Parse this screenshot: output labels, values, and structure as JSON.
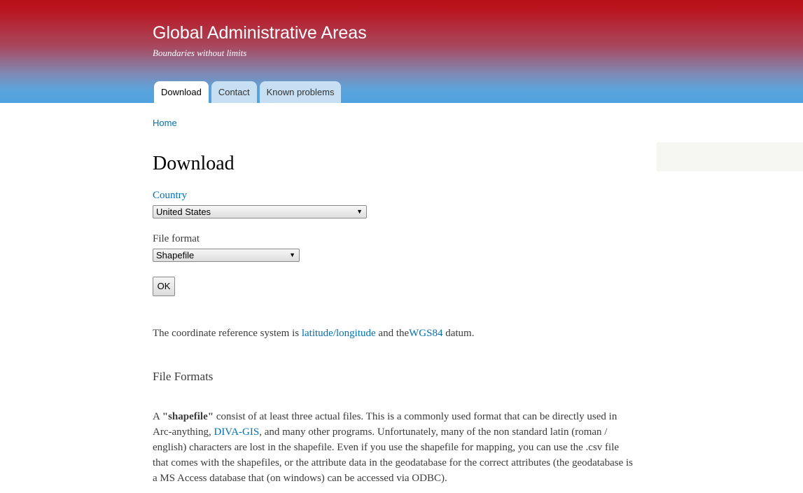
{
  "header": {
    "site_name": "Global Administrative Areas",
    "slogan": "Boundaries without limits",
    "colors": {
      "top": "#b80f16",
      "bottom": "#4fa2df"
    }
  },
  "tabs": [
    {
      "label": "Download",
      "active": true
    },
    {
      "label": "Contact",
      "active": false
    },
    {
      "label": "Known problems",
      "active": false
    }
  ],
  "breadcrumb": {
    "home": "Home"
  },
  "main": {
    "title": "Download",
    "form": {
      "country_label": "Country",
      "country_value": "United States",
      "format_label": "File format",
      "format_value": "Shapefile",
      "ok_label": "OK"
    },
    "crs": {
      "text_1": "The coordinate reference system is ",
      "link_1": "latitude/longitude",
      "text_2": " and the",
      "link_2": "WGS84",
      "text_3": " datum."
    },
    "file_formats_title": "File Formats",
    "shapefile": {
      "text_1": "A ",
      "bold": "\"shapefile\"",
      "text_2": " consist of at least three actual files. This is a commonly used format that can be directly used in Arc-anything, ",
      "link": "DIVA-GIS",
      "text_3": ", and many other programs. Unfortunately, many of the non standard latin (roman / english) characters are lost in the shapefile. Even if you use the shapefile for mapping, you can use the .csv file that comes with the shapefiles, or the attribute data in the geodatabase for the correct attributes (the geodatabase is a MS Access database that (on windows) can be accessed via ODBC)."
    }
  },
  "icons": {
    "select_arrow": "chevron-down-icon"
  },
  "accent_color": "#0071b3"
}
